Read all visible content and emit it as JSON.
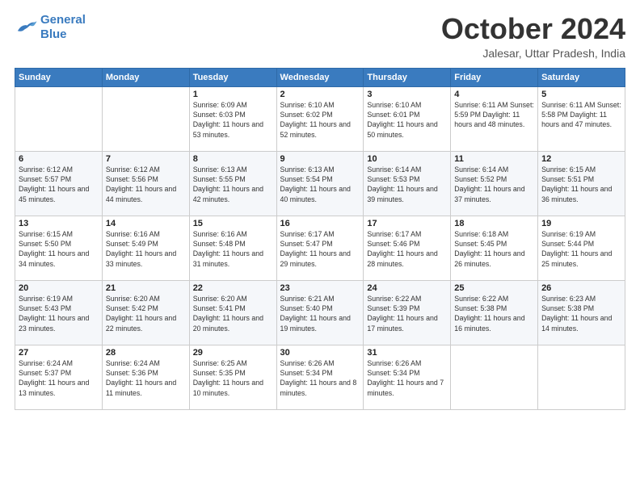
{
  "logo": {
    "line1": "General",
    "line2": "Blue"
  },
  "title": "October 2024",
  "subtitle": "Jalesar, Uttar Pradesh, India",
  "weekdays": [
    "Sunday",
    "Monday",
    "Tuesday",
    "Wednesday",
    "Thursday",
    "Friday",
    "Saturday"
  ],
  "weeks": [
    [
      {
        "day": "",
        "detail": ""
      },
      {
        "day": "",
        "detail": ""
      },
      {
        "day": "1",
        "detail": "Sunrise: 6:09 AM\nSunset: 6:03 PM\nDaylight: 11 hours and 53 minutes."
      },
      {
        "day": "2",
        "detail": "Sunrise: 6:10 AM\nSunset: 6:02 PM\nDaylight: 11 hours and 52 minutes."
      },
      {
        "day": "3",
        "detail": "Sunrise: 6:10 AM\nSunset: 6:01 PM\nDaylight: 11 hours and 50 minutes."
      },
      {
        "day": "4",
        "detail": "Sunrise: 6:11 AM\nSunset: 5:59 PM\nDaylight: 11 hours and 48 minutes."
      },
      {
        "day": "5",
        "detail": "Sunrise: 6:11 AM\nSunset: 5:58 PM\nDaylight: 11 hours and 47 minutes."
      }
    ],
    [
      {
        "day": "6",
        "detail": "Sunrise: 6:12 AM\nSunset: 5:57 PM\nDaylight: 11 hours and 45 minutes."
      },
      {
        "day": "7",
        "detail": "Sunrise: 6:12 AM\nSunset: 5:56 PM\nDaylight: 11 hours and 44 minutes."
      },
      {
        "day": "8",
        "detail": "Sunrise: 6:13 AM\nSunset: 5:55 PM\nDaylight: 11 hours and 42 minutes."
      },
      {
        "day": "9",
        "detail": "Sunrise: 6:13 AM\nSunset: 5:54 PM\nDaylight: 11 hours and 40 minutes."
      },
      {
        "day": "10",
        "detail": "Sunrise: 6:14 AM\nSunset: 5:53 PM\nDaylight: 11 hours and 39 minutes."
      },
      {
        "day": "11",
        "detail": "Sunrise: 6:14 AM\nSunset: 5:52 PM\nDaylight: 11 hours and 37 minutes."
      },
      {
        "day": "12",
        "detail": "Sunrise: 6:15 AM\nSunset: 5:51 PM\nDaylight: 11 hours and 36 minutes."
      }
    ],
    [
      {
        "day": "13",
        "detail": "Sunrise: 6:15 AM\nSunset: 5:50 PM\nDaylight: 11 hours and 34 minutes."
      },
      {
        "day": "14",
        "detail": "Sunrise: 6:16 AM\nSunset: 5:49 PM\nDaylight: 11 hours and 33 minutes."
      },
      {
        "day": "15",
        "detail": "Sunrise: 6:16 AM\nSunset: 5:48 PM\nDaylight: 11 hours and 31 minutes."
      },
      {
        "day": "16",
        "detail": "Sunrise: 6:17 AM\nSunset: 5:47 PM\nDaylight: 11 hours and 29 minutes."
      },
      {
        "day": "17",
        "detail": "Sunrise: 6:17 AM\nSunset: 5:46 PM\nDaylight: 11 hours and 28 minutes."
      },
      {
        "day": "18",
        "detail": "Sunrise: 6:18 AM\nSunset: 5:45 PM\nDaylight: 11 hours and 26 minutes."
      },
      {
        "day": "19",
        "detail": "Sunrise: 6:19 AM\nSunset: 5:44 PM\nDaylight: 11 hours and 25 minutes."
      }
    ],
    [
      {
        "day": "20",
        "detail": "Sunrise: 6:19 AM\nSunset: 5:43 PM\nDaylight: 11 hours and 23 minutes."
      },
      {
        "day": "21",
        "detail": "Sunrise: 6:20 AM\nSunset: 5:42 PM\nDaylight: 11 hours and 22 minutes."
      },
      {
        "day": "22",
        "detail": "Sunrise: 6:20 AM\nSunset: 5:41 PM\nDaylight: 11 hours and 20 minutes."
      },
      {
        "day": "23",
        "detail": "Sunrise: 6:21 AM\nSunset: 5:40 PM\nDaylight: 11 hours and 19 minutes."
      },
      {
        "day": "24",
        "detail": "Sunrise: 6:22 AM\nSunset: 5:39 PM\nDaylight: 11 hours and 17 minutes."
      },
      {
        "day": "25",
        "detail": "Sunrise: 6:22 AM\nSunset: 5:38 PM\nDaylight: 11 hours and 16 minutes."
      },
      {
        "day": "26",
        "detail": "Sunrise: 6:23 AM\nSunset: 5:38 PM\nDaylight: 11 hours and 14 minutes."
      }
    ],
    [
      {
        "day": "27",
        "detail": "Sunrise: 6:24 AM\nSunset: 5:37 PM\nDaylight: 11 hours and 13 minutes."
      },
      {
        "day": "28",
        "detail": "Sunrise: 6:24 AM\nSunset: 5:36 PM\nDaylight: 11 hours and 11 minutes."
      },
      {
        "day": "29",
        "detail": "Sunrise: 6:25 AM\nSunset: 5:35 PM\nDaylight: 11 hours and 10 minutes."
      },
      {
        "day": "30",
        "detail": "Sunrise: 6:26 AM\nSunset: 5:34 PM\nDaylight: 11 hours and 8 minutes."
      },
      {
        "day": "31",
        "detail": "Sunrise: 6:26 AM\nSunset: 5:34 PM\nDaylight: 11 hours and 7 minutes."
      },
      {
        "day": "",
        "detail": ""
      },
      {
        "day": "",
        "detail": ""
      }
    ]
  ]
}
